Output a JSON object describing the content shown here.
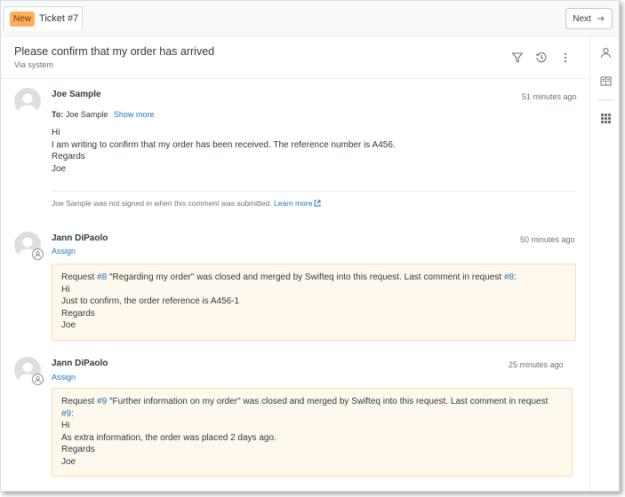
{
  "tab": {
    "status_badge": "New",
    "label": "Ticket #7"
  },
  "toolbar": {
    "next_label": "Next"
  },
  "header": {
    "title": "Please confirm that my order has arrived",
    "via": "Via system"
  },
  "comments": [
    {
      "author": "Joe Sample",
      "time": "51 minutes ago",
      "to_label": "To:",
      "to_value": "Joe Sample",
      "show_more": "Show more",
      "lines": [
        "Hi",
        "I am writing to confirm that my order has been received. The reference number is A456.",
        "Regards",
        "Joe"
      ],
      "notice": "Joe Sample was not signed in when this comment was submitted.",
      "learn_more": "Learn more"
    },
    {
      "author": "Jann DiPaolo",
      "time": "50 minutes ago",
      "assign": "Assign",
      "merge_prefix": "Request",
      "merge_request": "#8",
      "merge_middle": "\"Regarding my order\" was closed and merged by Swifteq into this request. Last comment in request",
      "merge_request_ref": "#8",
      "merge_suffix": ":",
      "lines": [
        "Hi",
        "Just to confirm, the order reference is A456-1",
        "Regards",
        "Joe"
      ]
    },
    {
      "author": "Jann DiPaolo",
      "time": "25 minutes ago",
      "assign": "Assign",
      "merge_prefix": "Request",
      "merge_request": "#9",
      "merge_middle": "\"Further information on my order\" was closed and merged by Swifteq into this request. Last comment in request",
      "merge_request_ref": "#9",
      "merge_suffix": ":",
      "lines": [
        "Hi",
        "As extra information, the order was placed 2 days ago.",
        "Regards",
        "Joe"
      ]
    }
  ],
  "icons": {
    "filter": "filter-icon",
    "history": "history-icon",
    "more": "more-vertical-icon",
    "user": "user-icon",
    "knowledge": "book-icon",
    "apps": "apps-grid-icon",
    "external": "external-link-icon"
  },
  "colors": {
    "accent": "#1f73b7",
    "new_badge": "#ffb057",
    "merge_bg": "#fff8ed",
    "merge_border": "#fcdba9"
  }
}
